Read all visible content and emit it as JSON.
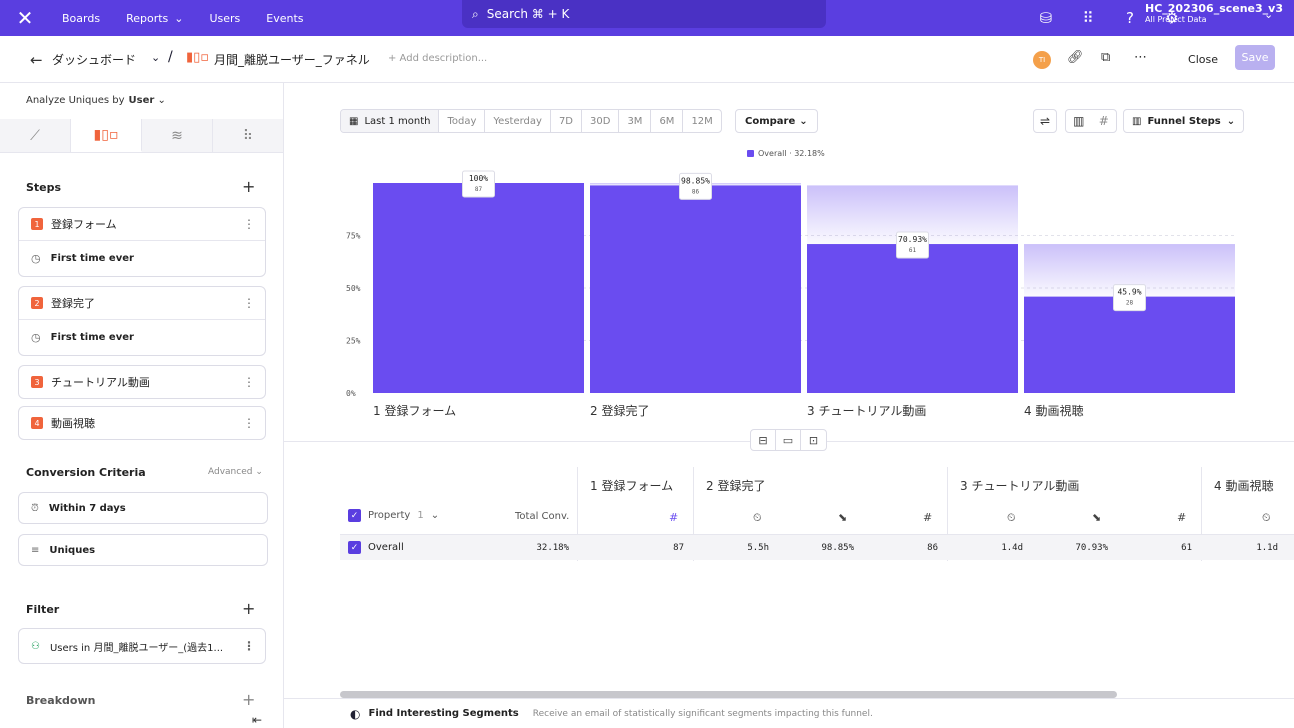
{
  "nav": {
    "boards": "Boards",
    "reports": "Reports",
    "users": "Users",
    "events": "Events",
    "search": "Search ⌘ + K",
    "project_name": "HC_202306_scene3_v3",
    "project_sub": "All Project Data"
  },
  "header": {
    "back": "←",
    "dashboard": "ダッシュボード",
    "slash": "/",
    "title": "月間_離脱ユーザー_ファネル",
    "add_description": "+ Add description...",
    "avatar": "TI",
    "close": "Close",
    "save": "Save"
  },
  "sidebar": {
    "analyze_label": "Analyze Uniques by",
    "analyze_value": "User",
    "steps_title": "Steps",
    "steps": [
      {
        "num": "1",
        "label": "登録フォーム",
        "sub": "First time ever"
      },
      {
        "num": "2",
        "label": "登録完了",
        "sub": "First time ever"
      },
      {
        "num": "3",
        "label": "チュートリアル動画"
      },
      {
        "num": "4",
        "label": "動画視聴"
      }
    ],
    "conversion_title": "Conversion Criteria",
    "advanced": "Advanced",
    "within": "Within 7 days",
    "uniques": "Uniques",
    "filter_title": "Filter",
    "filter_item": "Users in 月間_離脱ユーザー_(過去1...",
    "breakdown_title": "Breakdown"
  },
  "toolbar": {
    "date_options": [
      "Last 1 month",
      "Today",
      "Yesterday",
      "7D",
      "30D",
      "3M",
      "6M",
      "12M"
    ],
    "compare": "Compare",
    "funnel_steps": "Funnel Steps"
  },
  "chart_data": {
    "type": "bar",
    "categories": [
      "1 登録フォーム",
      "2 登録完了",
      "3 チュートリアル動画",
      "4 動画視聴"
    ],
    "series": [
      {
        "name": "Overall · 32.18%",
        "values": [
          100,
          98.85,
          70.93,
          45.9
        ],
        "counts": [
          87,
          86,
          61,
          28
        ]
      }
    ],
    "value_labels": [
      "100%",
      "98.85%",
      "70.93%",
      "45.9%"
    ],
    "count_labels": [
      "87",
      "86",
      "61",
      "28"
    ],
    "yticks": [
      "0%",
      "25%",
      "50%",
      "75%"
    ],
    "ylim": [
      0,
      100
    ],
    "dropoff_from": [
      null,
      100,
      98.85,
      70.93
    ],
    "bar_color": "#6a4cf0"
  },
  "table": {
    "property_label": "Property",
    "property_count": "1",
    "total_conv_label": "Total Conv.",
    "step_headers": [
      "1 登録フォーム",
      "2 登録完了",
      "3 チュートリアル動画",
      "4 動画視聴"
    ],
    "row": {
      "name": "Overall",
      "total_conv": "32.18%",
      "values": [
        "87",
        "5.5h",
        "98.85%",
        "86",
        "1.4d",
        "70.93%",
        "61",
        "1.1d"
      ]
    }
  },
  "footer": {
    "title": "Find Interesting Segments",
    "desc": "Receive an email of statistically significant segments impacting this funnel."
  }
}
